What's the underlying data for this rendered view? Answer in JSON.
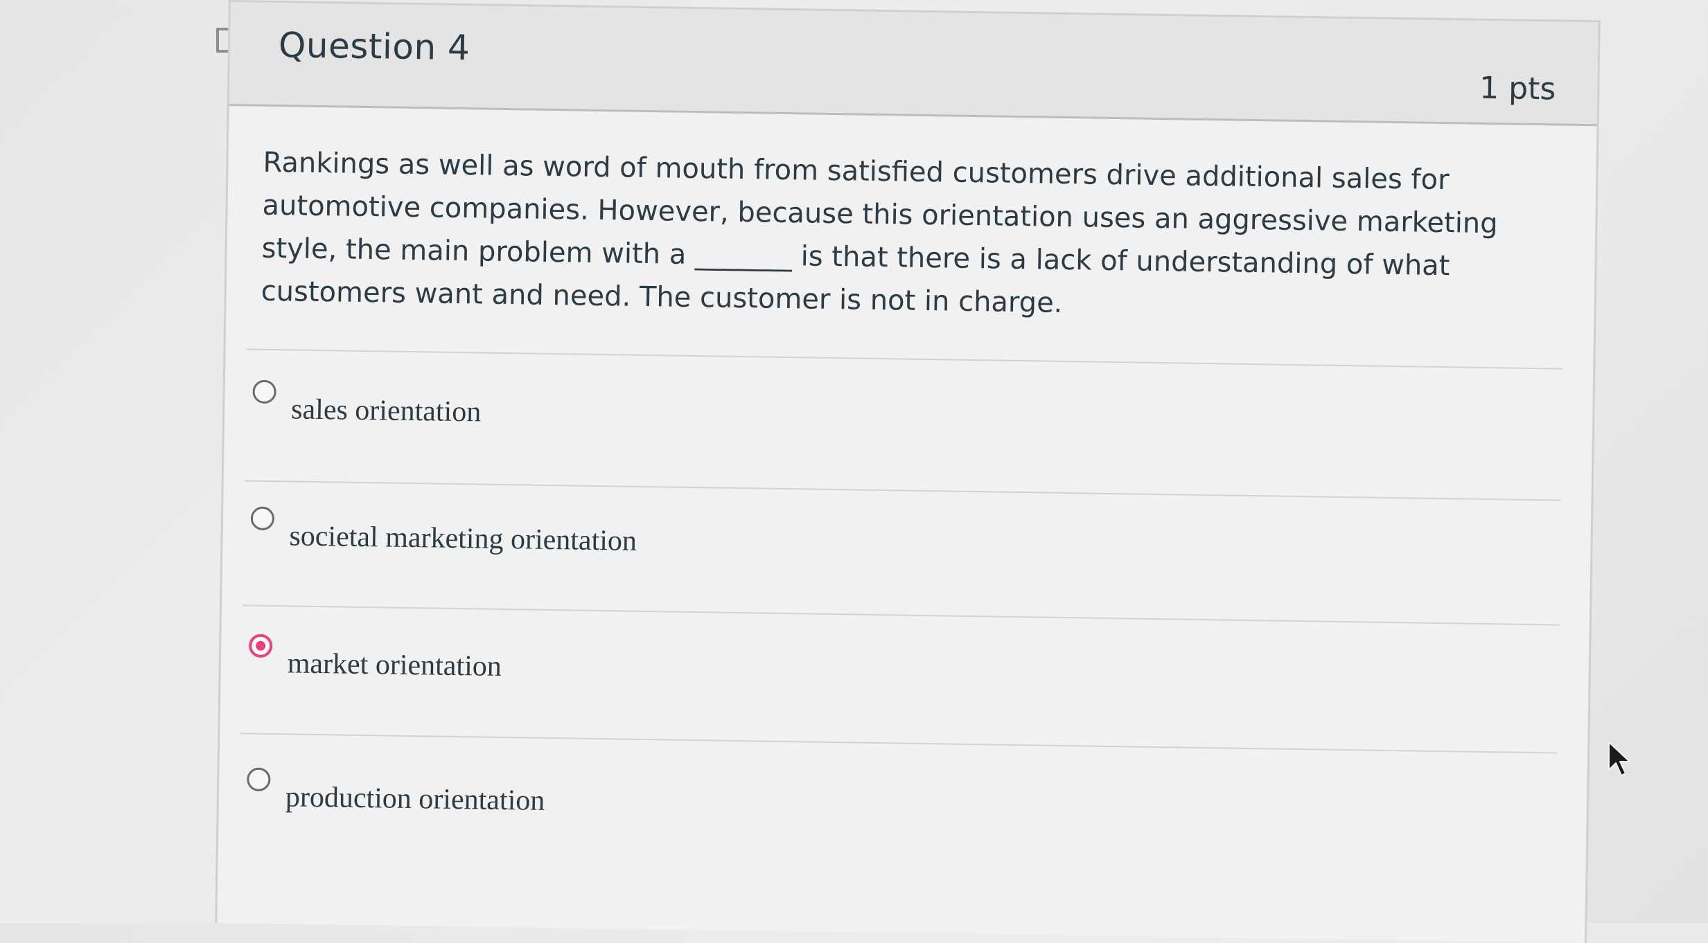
{
  "question": {
    "title": "Question 4",
    "points": "1 pts",
    "text": "Rankings as well as word of mouth from satisfied customers drive additional sales for automotive companies. However, because this orientation uses an aggressive marketing style, the main problem with a _______ is that there is a lack of understanding of what customers want and need. The customer is not in charge."
  },
  "answers": [
    {
      "label": "sales orientation",
      "selected": false
    },
    {
      "label": "societal marketing orientation",
      "selected": false
    },
    {
      "label": "market orientation",
      "selected": true
    },
    {
      "label": "production orientation",
      "selected": false
    }
  ],
  "colors": {
    "selected_accent": "#e8427c",
    "text": "#2d3b45",
    "header_bg": "#e4e4e4"
  },
  "icons": [
    "flag-icon",
    "radio-icon",
    "mouse-cursor-icon"
  ]
}
